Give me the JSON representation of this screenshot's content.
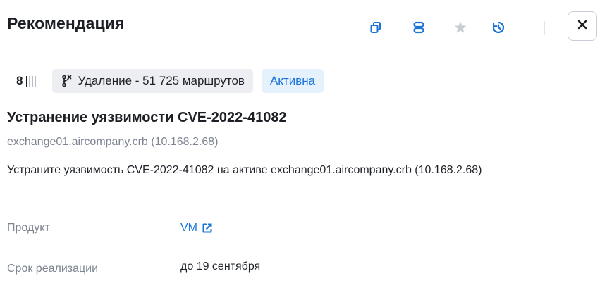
{
  "header": {
    "title": "Рекомендация",
    "icons": [
      "copy-icon",
      "database-icon",
      "star-icon",
      "history-icon",
      "close-icon"
    ],
    "accent": "#1a74d9"
  },
  "meta": {
    "priority_number": "8",
    "priority_level": 1,
    "priority_max": 4,
    "route_chip": "Удаление - 51 725 маршрутов",
    "status": "Активна"
  },
  "recommendation": {
    "heading": "Устранение уязвимости CVE-2022-41082",
    "host": "exchange01.aircompany.crb (10.168.2.68)",
    "description": "Устраните уязвимость CVE-2022-41082 на активе exchange01.aircompany.crb (10.168.2.68)"
  },
  "fields": {
    "product_label": "Продукт",
    "product_value": "VM",
    "deadline_label": "Срок реализации",
    "deadline_value": "до 19 сентября"
  }
}
